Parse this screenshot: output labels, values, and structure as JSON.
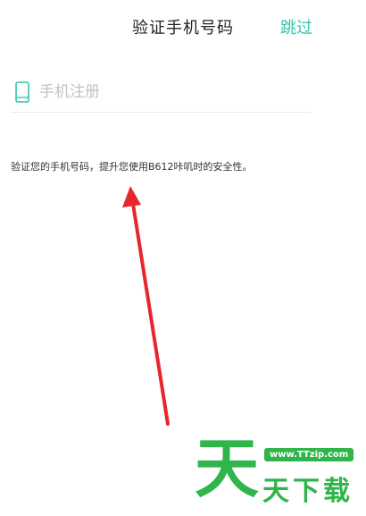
{
  "header": {
    "title": "验证手机号码",
    "skip_label": "跳过"
  },
  "phone_input": {
    "placeholder": "手机注册",
    "value": ""
  },
  "description": "验证您的手机号码，提升您使用B612咔叽时的安全性。",
  "watermark": {
    "url": "www.TTzip.com",
    "big_char": "天",
    "small_text": "天下载"
  },
  "colors": {
    "accent": "#35c3ad",
    "arrow": "#e8262e",
    "watermark": "#2fb54a"
  }
}
